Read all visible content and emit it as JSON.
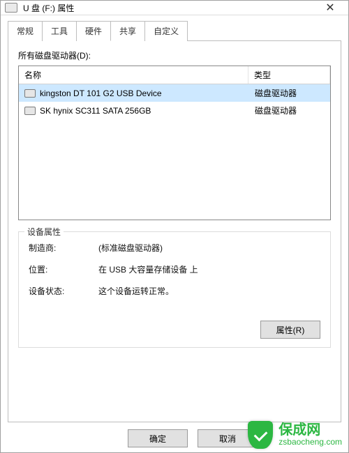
{
  "window": {
    "title": "U 盘 (F:) 属性",
    "close_glyph": "✕"
  },
  "tabs": [
    {
      "label": "常规"
    },
    {
      "label": "工具"
    },
    {
      "label": "硬件",
      "active": true
    },
    {
      "label": "共享"
    },
    {
      "label": "自定义"
    }
  ],
  "hardware": {
    "all_drives_label": "所有磁盘驱动器(D):",
    "columns": {
      "name": "名称",
      "type": "类型"
    },
    "rows": [
      {
        "name": "kingston DT 101 G2 USB Device",
        "type": "磁盘驱动器",
        "selected": true
      },
      {
        "name": "SK hynix SC311 SATA 256GB",
        "type": "磁盘驱动器",
        "selected": false
      }
    ],
    "device_props": {
      "legend": "设备属性",
      "manufacturer_label": "制造商:",
      "manufacturer_value": "(标准磁盘驱动器)",
      "location_label": "位置:",
      "location_value": "在 USB 大容量存储设备 上",
      "status_label": "设备状态:",
      "status_value": "这个设备运转正常。",
      "properties_button": "属性(R)"
    }
  },
  "buttons": {
    "ok": "确定",
    "cancel": "取消"
  },
  "watermark": {
    "big": "保成网",
    "small": "zsbaocheng.com"
  }
}
